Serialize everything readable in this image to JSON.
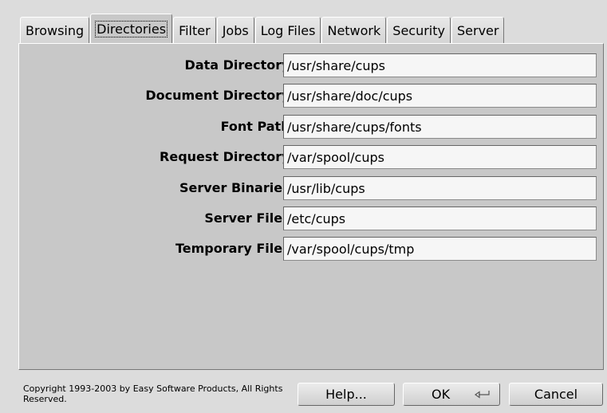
{
  "tabs": [
    {
      "label": "Browsing",
      "active": false
    },
    {
      "label": "Directories",
      "active": true
    },
    {
      "label": "Filter",
      "active": false
    },
    {
      "label": "Jobs",
      "active": false
    },
    {
      "label": "Log Files",
      "active": false
    },
    {
      "label": "Network",
      "active": false
    },
    {
      "label": "Security",
      "active": false
    },
    {
      "label": "Server",
      "active": false
    }
  ],
  "fields": [
    {
      "label": "Data Directory:",
      "value": "/usr/share/cups"
    },
    {
      "label": "Document Directory:",
      "value": "/usr/share/doc/cups"
    },
    {
      "label": "Font Path:",
      "value": "/usr/share/cups/fonts"
    },
    {
      "label": "Request Directory:",
      "value": "/var/spool/cups"
    },
    {
      "label": "Server Binaries:",
      "value": "/usr/lib/cups"
    },
    {
      "label": "Server Files:",
      "value": "/etc/cups"
    },
    {
      "label": "Temporary Files:",
      "value": "/var/spool/cups/tmp"
    }
  ],
  "footer": {
    "copyright": "Copyright 1993-2003 by Easy Software Products, All Rights Reserved.",
    "help_label": "Help...",
    "ok_label": "OK",
    "ok_icon": "return-key-icon",
    "cancel_label": "Cancel"
  }
}
